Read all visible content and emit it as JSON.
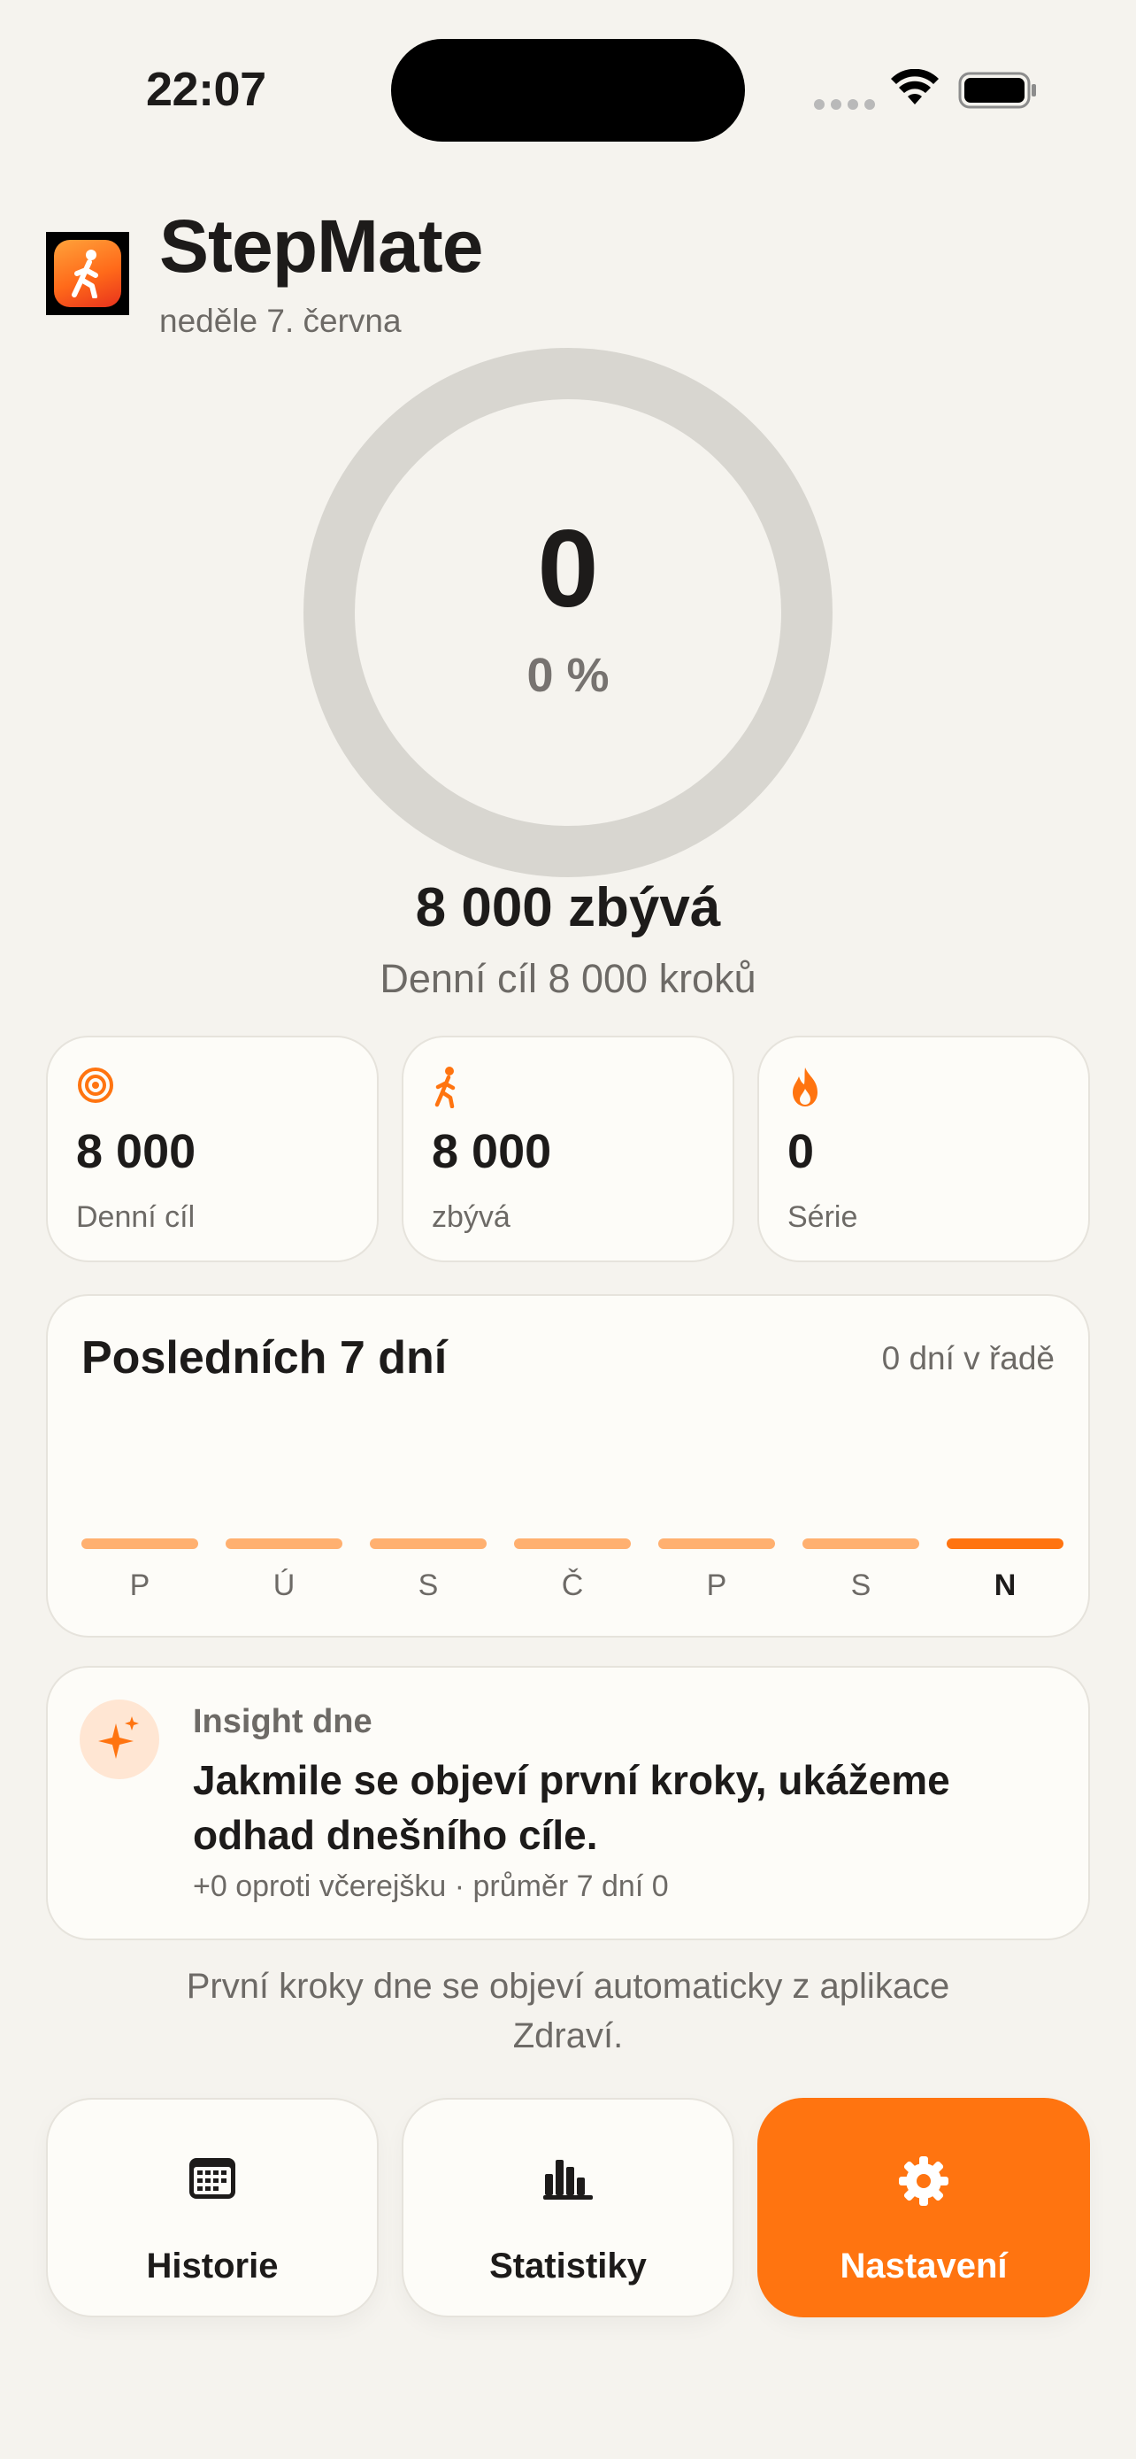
{
  "status_bar": {
    "time": "22:07"
  },
  "header": {
    "title": "StepMate",
    "date": "neděle 7. června"
  },
  "ring": {
    "steps": "0",
    "percent_text": "0 %",
    "progress": 0
  },
  "summary": {
    "remaining": "8 000 zbývá",
    "goal_caption": "Denní cíl 8 000 kroků"
  },
  "stats": [
    {
      "icon": "target-icon",
      "value": "8 000",
      "label": "Denní cíl"
    },
    {
      "icon": "walking-icon",
      "value": "8 000",
      "label": "zbývá"
    },
    {
      "icon": "flame-icon",
      "value": "0",
      "label": "Série"
    }
  ],
  "week": {
    "title": "Posledních 7 dní",
    "streak": "0 dní v řadě",
    "days": [
      "P",
      "Ú",
      "S",
      "Č",
      "P",
      "S",
      "N"
    ],
    "values": [
      0,
      0,
      0,
      0,
      0,
      0,
      0
    ],
    "active_index": 6
  },
  "insight": {
    "label": "Insight dne",
    "text": "Jakmile se objeví první kroky, ukážeme odhad dnešního cíle.",
    "sub": "+0 oproti včerejšku · průměr 7 dní 0"
  },
  "footnote": "První kroky dne se objeví automaticky z aplikace Zdraví.",
  "nav": {
    "history": "Historie",
    "stats": "Statistiky",
    "settings": "Nastavení"
  },
  "colors": {
    "accent": "#ff7410",
    "accent_light": "#ffb070",
    "ring_track": "#d8d6d0",
    "background": "#f5f3ee"
  }
}
